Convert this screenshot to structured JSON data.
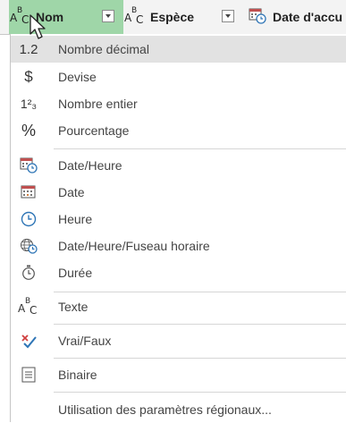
{
  "columns": [
    {
      "label": "Nom",
      "type_icon": "text-type-icon"
    },
    {
      "label": "Espèce",
      "type_icon": "text-type-icon"
    },
    {
      "label": "Date d'accu",
      "type_icon": "datetime-type-icon"
    }
  ],
  "menu": {
    "items": [
      {
        "label": "Nombre décimal",
        "icon": "decimal-icon",
        "glyph": "1.2"
      },
      {
        "label": "Devise",
        "icon": "currency-icon",
        "glyph": "$"
      },
      {
        "label": "Nombre entier",
        "icon": "integer-icon",
        "glyph": "1²₃"
      },
      {
        "label": "Pourcentage",
        "icon": "percent-icon",
        "glyph": "%"
      },
      {
        "label": "Date/Heure",
        "icon": "datetime-icon"
      },
      {
        "label": "Date",
        "icon": "date-icon"
      },
      {
        "label": "Heure",
        "icon": "time-icon"
      },
      {
        "label": "Date/Heure/Fuseau horaire",
        "icon": "timezone-icon"
      },
      {
        "label": "Durée",
        "icon": "duration-icon"
      },
      {
        "label": "Texte",
        "icon": "text-icon"
      },
      {
        "label": "Vrai/Faux",
        "icon": "boolean-icon"
      },
      {
        "label": "Binaire",
        "icon": "binary-icon"
      },
      {
        "label": "Utilisation des paramètres régionaux...",
        "icon": ""
      }
    ]
  },
  "colors": {
    "active_column": "#9fd6a8",
    "hover_row": "#e2e2e2",
    "clock_blue": "#2e75b6",
    "check_red": "#d04040"
  }
}
